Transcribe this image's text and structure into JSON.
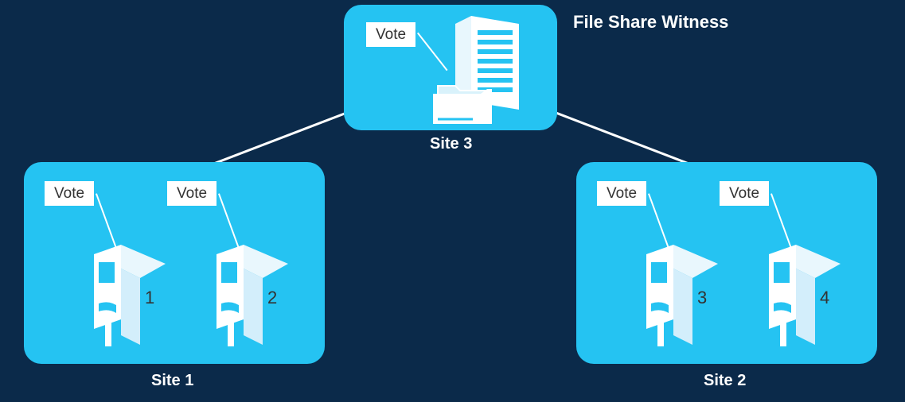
{
  "title": "File Share Witness",
  "sites": {
    "site3": {
      "label": "Site 3",
      "vote": "Vote"
    },
    "site1": {
      "label": "Site 1",
      "node1": {
        "vote": "Vote",
        "num": "1"
      },
      "node2": {
        "vote": "Vote",
        "num": "2"
      }
    },
    "site2": {
      "label": "Site 2",
      "node3": {
        "vote": "Vote",
        "num": "3"
      },
      "node4": {
        "vote": "Vote",
        "num": "4"
      }
    }
  }
}
